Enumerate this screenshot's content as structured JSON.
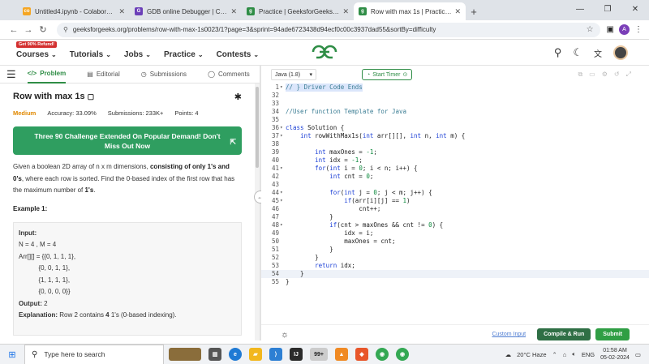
{
  "browser": {
    "tabs": [
      {
        "title": "Untitled4.ipynb - Colaboratory",
        "color": "#f5a623",
        "glyph": "co"
      },
      {
        "title": "GDB online Debugger | Compiler - C",
        "color": "#6b3fb8",
        "glyph": "G"
      },
      {
        "title": "Practice | GeeksforGeeks | A comp",
        "color": "#2f8d46",
        "glyph": "g"
      },
      {
        "title": "Row with max 1s | Practice | Geeks",
        "color": "#2f8d46",
        "glyph": "g"
      }
    ],
    "url": "geeksforgeeks.org/problems/row-with-max-1s0023/1?page=3&sprint=94ade6723438d94ecf0c00c3937dad55&sortBy=difficulty",
    "profile_initial": "A"
  },
  "nav": {
    "badge": "Get 90% Refund!",
    "items": [
      "Courses",
      "Tutorials",
      "Jobs",
      "Practice",
      "Contests"
    ]
  },
  "left_tabs": [
    "Problem",
    "Editorial",
    "Submissions",
    "Comments"
  ],
  "problem": {
    "title": "Row with max 1s",
    "difficulty": "Medium",
    "accuracy": "Accuracy: 33.09%",
    "submissions": "Submissions: 233K+",
    "points": "Points: 4",
    "banner": "Three 90 Challenge Extended On Popular Demand! Don't Miss Out Now",
    "desc_1": "Given a boolean 2D array of n x m dimensions, ",
    "desc_2": "consisting of only 1's and 0's",
    "desc_3": ", where each row is sorted. Find the 0-based index of the first row that has the maximum number of ",
    "desc_4": "1's",
    "desc_5": ".",
    "example_label": "Example 1:",
    "input_label": "Input:",
    "input_nm": "N = 4 , M = 4",
    "input_arr": "Arr[][] = {{0, 1, 1, 1},\n           {0, 0, 1, 1},\n           {1, 1, 1, 1},\n           {0, 0, 0, 0}}",
    "output_label": "Output:",
    "output_value": "2",
    "expl_label": "Explanation:",
    "expl_1": "Row 2 contains ",
    "expl_2": "4",
    "expl_3": " 1's (0-based indexing)."
  },
  "editor": {
    "language": "Java (1.8)",
    "timer": "Start Timer",
    "lines": [
      {
        "n": "1",
        "fold": true,
        "code": "// } Driver Code Ends",
        "cls": "cm",
        "hl": true
      },
      {
        "n": "32",
        "fold": false,
        "code": ""
      },
      {
        "n": "33",
        "fold": false,
        "code": ""
      },
      {
        "n": "34",
        "fold": false,
        "code": "//User function Template for Java",
        "cls": "cm"
      },
      {
        "n": "35",
        "fold": false,
        "code": ""
      },
      {
        "n": "36",
        "fold": true,
        "code": "class Solution {"
      },
      {
        "n": "37",
        "fold": true,
        "code": "    int rowWithMax1s(int arr[][], int n, int m) {"
      },
      {
        "n": "38",
        "fold": false,
        "code": ""
      },
      {
        "n": "39",
        "fold": false,
        "code": "        int maxOnes = -1;"
      },
      {
        "n": "40",
        "fold": false,
        "code": "        int idx = -1;"
      },
      {
        "n": "41",
        "fold": true,
        "code": "        for(int i = 0; i < n; i++) {"
      },
      {
        "n": "42",
        "fold": false,
        "code": "            int cnt = 0;"
      },
      {
        "n": "43",
        "fold": false,
        "code": ""
      },
      {
        "n": "44",
        "fold": true,
        "code": "            for(int j = 0; j < m; j++) {"
      },
      {
        "n": "45",
        "fold": true,
        "code": "                if(arr[i][j] == 1)"
      },
      {
        "n": "46",
        "fold": false,
        "code": "                    cnt++;"
      },
      {
        "n": "47",
        "fold": false,
        "code": "            }"
      },
      {
        "n": "48",
        "fold": true,
        "code": "            if(cnt > maxOnes && cnt != 0) {"
      },
      {
        "n": "49",
        "fold": false,
        "code": "                idx = i;"
      },
      {
        "n": "50",
        "fold": false,
        "code": "                maxOnes = cnt;"
      },
      {
        "n": "51",
        "fold": false,
        "code": "            }"
      },
      {
        "n": "52",
        "fold": false,
        "code": "        }"
      },
      {
        "n": "53",
        "fold": false,
        "code": "        return idx;"
      },
      {
        "n": "54",
        "fold": false,
        "code": "    }",
        "cur": true
      },
      {
        "n": "55",
        "fold": false,
        "code": "}"
      }
    ],
    "custom_input": "Custom Input",
    "compile_run": "Compile & Run",
    "submit": "Submit"
  },
  "taskbar": {
    "search_placeholder": "Type here to search",
    "weather": "20°C  Haze",
    "lang": "ENG",
    "time": "01:58 AM",
    "date": "05-02-2024",
    "badge": "99+"
  }
}
